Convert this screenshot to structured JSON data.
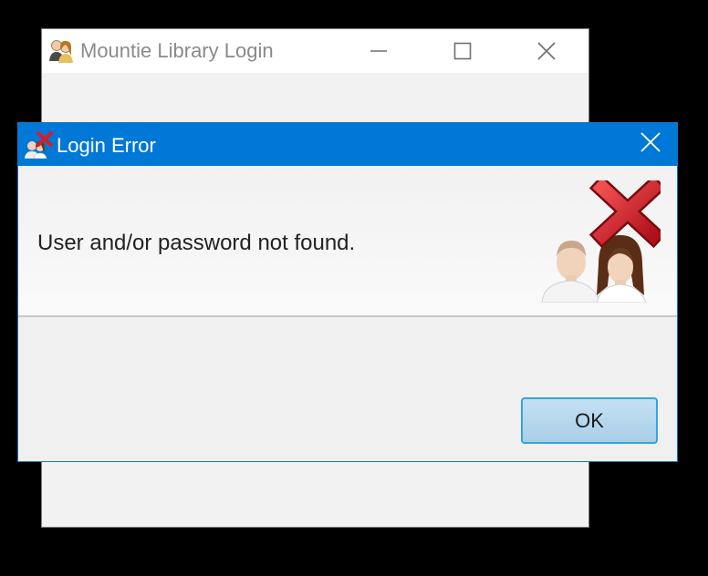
{
  "main_window": {
    "title": "Mountie Library Login",
    "icons": {
      "app": "users-icon",
      "minimize": "minimize-icon",
      "maximize": "maximize-icon",
      "close": "close-icon"
    }
  },
  "dialog": {
    "title": "Login Error",
    "message": "User and/or password not found.",
    "ok_label": "OK",
    "icons": {
      "title": "users-error-icon",
      "graphic": "users-error-icon",
      "close": "close-icon"
    },
    "colors": {
      "titlebar": "#0078d7",
      "error_x": "#d0202a",
      "ok_border": "#33a3e0"
    }
  }
}
